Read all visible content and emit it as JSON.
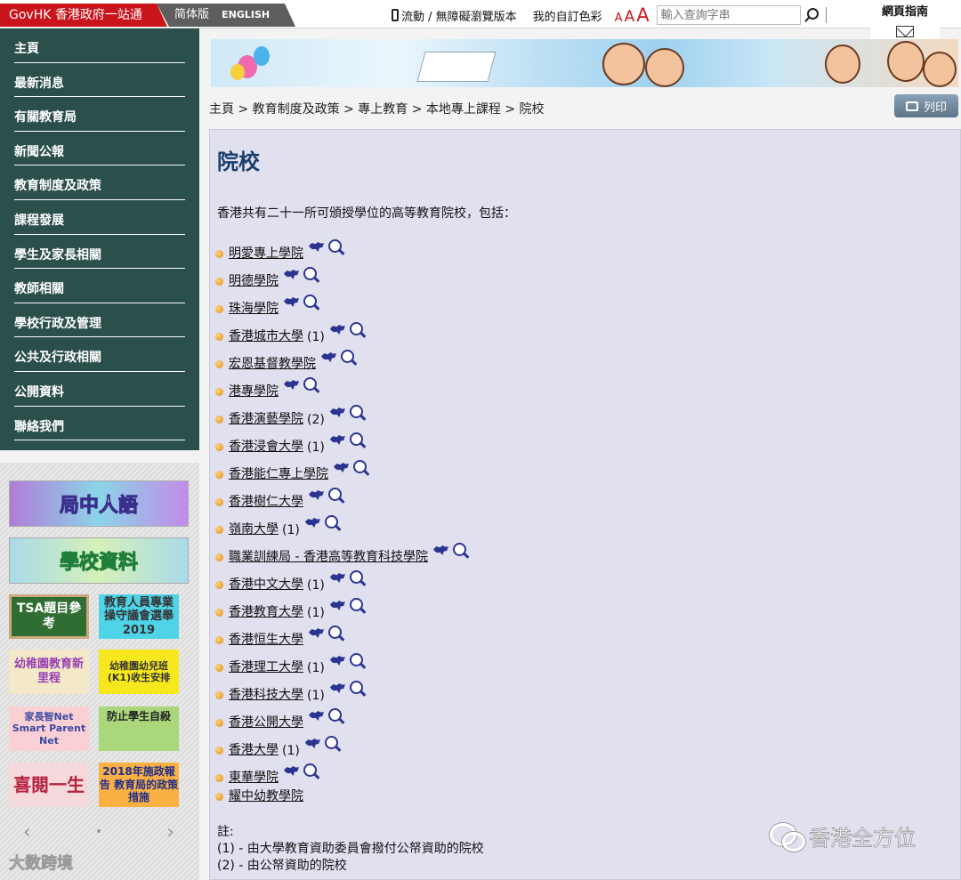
{
  "topbar": {
    "gov_label": "GovHK 香港政府一站通",
    "lang_simplified": "简体版",
    "lang_english": "ENGLISH",
    "mobile_label": "流動 / 無障礙瀏覽版本",
    "colour_label": "我的自訂色彩",
    "font_sizes": [
      "A",
      "A",
      "A"
    ],
    "search_placeholder": "輸入查詢字串",
    "guide_label": "網頁指南",
    "icons": [
      "mobile-icon",
      "search-icon",
      "mail-icon"
    ]
  },
  "sidebar": {
    "items": [
      {
        "label": "主頁"
      },
      {
        "label": "最新消息"
      },
      {
        "label": "有關教育局"
      },
      {
        "label": "新聞公報"
      },
      {
        "label": "教育制度及政策"
      },
      {
        "label": "課程發展"
      },
      {
        "label": "學生及家長相關"
      },
      {
        "label": "教師相關"
      },
      {
        "label": "學校行政及管理"
      },
      {
        "label": "公共及行政相關"
      },
      {
        "label": "公開資料"
      },
      {
        "label": "聯絡我們"
      }
    ]
  },
  "promo": {
    "banner1": "局中人語",
    "banner2": "學校資料",
    "tiles": [
      "TSA題目參考",
      "教育人員專業操守議會選舉2019",
      "幼稚園教育新里程",
      "幼稚園幼兒班(K1)收生安排",
      "家長智Net Smart Parent Net",
      "防止學生自殺",
      "喜閱一生",
      "2018年施政報告 教育局的政策措施"
    ],
    "carousel_prev": "‹",
    "carousel_dot": "•",
    "carousel_next": "›",
    "watermark": "大数跨境"
  },
  "breadcrumb": "主頁 > 教育制度及政策 > 專上教育 > 本地專上課程 > 院校",
  "print_label": "列印",
  "page_title": "院校",
  "intro": "香港共有二十一所可頒授學位的高等教育院校，包括：",
  "institutions": [
    {
      "name": "明愛專上學院",
      "note": ""
    },
    {
      "name": "明德學院",
      "note": ""
    },
    {
      "name": "珠海學院",
      "note": ""
    },
    {
      "name": "香港城市大學",
      "note": "(1)"
    },
    {
      "name": "宏恩基督教學院",
      "note": ""
    },
    {
      "name": "港專學院",
      "note": ""
    },
    {
      "name": "香港演藝學院",
      "note": "(2)"
    },
    {
      "name": "香港浸會大學",
      "note": "(1)"
    },
    {
      "name": "香港能仁專上學院",
      "note": ""
    },
    {
      "name": "香港樹仁大學",
      "note": ""
    },
    {
      "name": "嶺南大學",
      "note": "(1)"
    },
    {
      "name": "職業訓練局 - 香港高等教育科技學院",
      "note": ""
    },
    {
      "name": "香港中文大學",
      "note": "(1)"
    },
    {
      "name": "香港教育大學",
      "note": "(1)"
    },
    {
      "name": "香港恒生大學",
      "note": ""
    },
    {
      "name": "香港理工大學",
      "note": "(1)"
    },
    {
      "name": "香港科技大學",
      "note": "(1)"
    },
    {
      "name": "香港公開大學",
      "note": ""
    },
    {
      "name": "香港大學",
      "note": "(1)"
    },
    {
      "name": "東華學院",
      "note": ""
    },
    {
      "name": "耀中幼教學院",
      "note": ""
    }
  ],
  "notes": {
    "heading": "註:",
    "items": [
      "(1) - 由大學教育資助委員會撥付公帑資助的院校",
      "(2) - 由公帑資助的院校"
    ]
  },
  "watermark": "香港全方位",
  "icons": {
    "map": "map-icon",
    "magnifier": "magnifier-icon",
    "bullet": "bullet-icon",
    "printer": "printer-icon",
    "wechat": "wechat-icon"
  }
}
